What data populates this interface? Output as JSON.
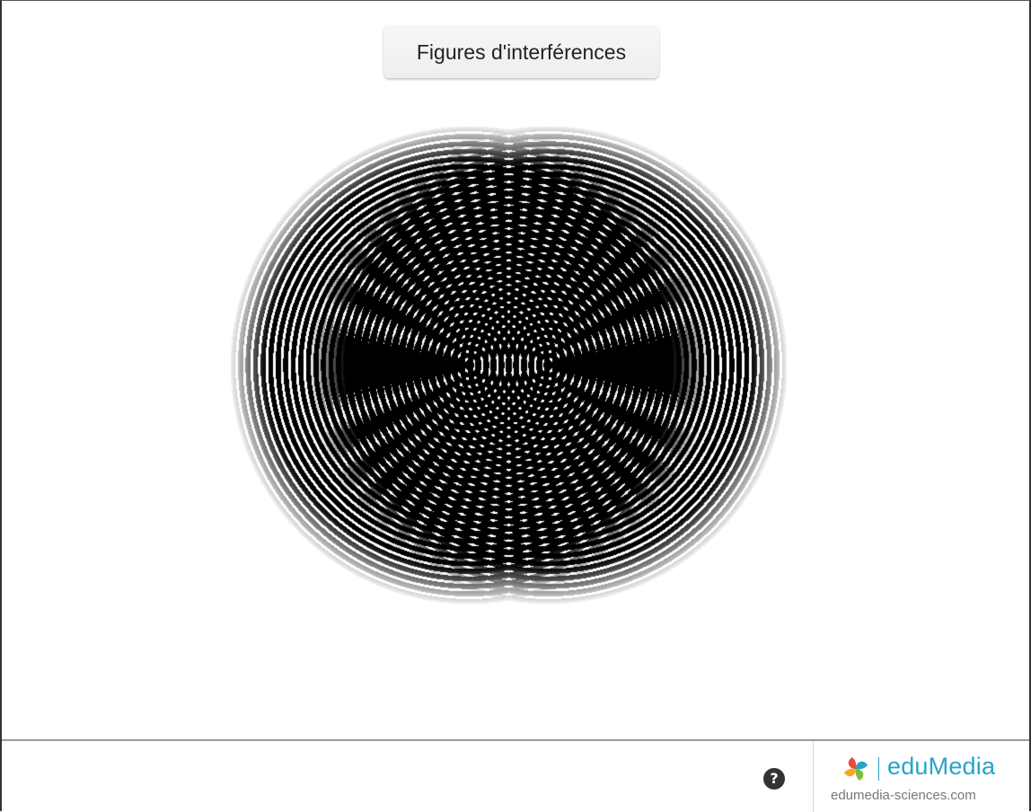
{
  "header": {
    "title_button_label": "Figures d'interférences"
  },
  "simulation": {
    "sources": 2,
    "ring_color": "#000000",
    "background_color": "#ffffff"
  },
  "footer": {
    "help_label": "?",
    "help_icon": "question-circle-icon",
    "brand": {
      "name": "eduMedia",
      "url_text": "edumedia-sciences.com",
      "logo_icon": "edumedia-pinwheel-icon",
      "name_color": "#27a3c9",
      "logo_colors": [
        "#e84c3d",
        "#f5a623",
        "#7dbf3a",
        "#27a3c9"
      ]
    }
  }
}
